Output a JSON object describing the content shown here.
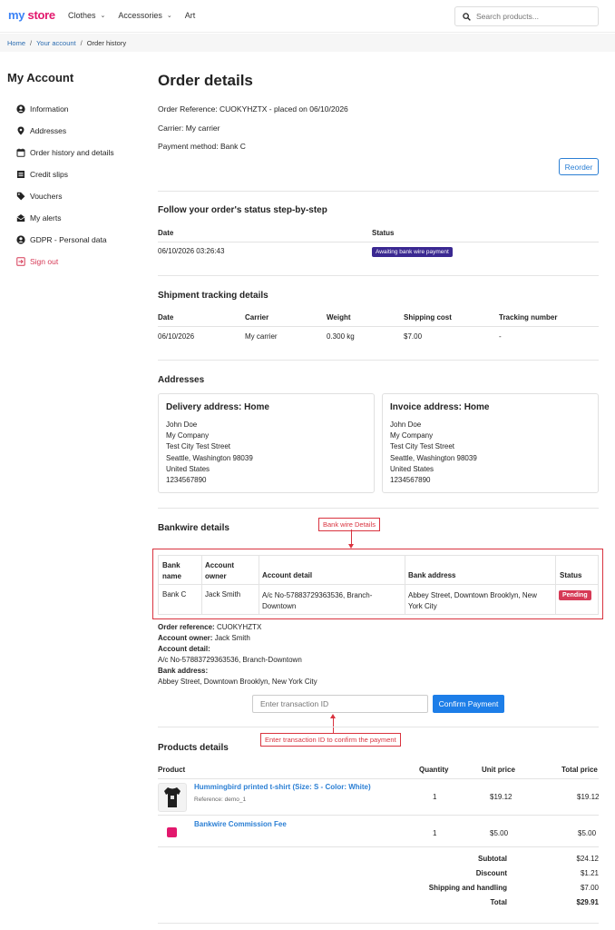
{
  "header": {
    "logo_my": "my",
    "logo_store": "store",
    "nav": [
      {
        "label": "Clothes",
        "has_dropdown": true
      },
      {
        "label": "Accessories",
        "has_dropdown": true
      },
      {
        "label": "Art",
        "has_dropdown": false
      }
    ],
    "search_placeholder": "Search products..."
  },
  "breadcrumb": {
    "items": [
      "Home",
      "Your account",
      "Order history"
    ],
    "separator": "/"
  },
  "sidebar": {
    "title": "My Account",
    "items": [
      {
        "label": "Information",
        "icon": "user-icon"
      },
      {
        "label": "Addresses",
        "icon": "map-pin-icon"
      },
      {
        "label": "Order history and details",
        "icon": "calendar-icon"
      },
      {
        "label": "Credit slips",
        "icon": "list-icon"
      },
      {
        "label": "Vouchers",
        "icon": "tag-icon"
      },
      {
        "label": "My alerts",
        "icon": "envelope-open-icon"
      },
      {
        "label": "GDPR - Personal data",
        "icon": "user-circle-icon"
      },
      {
        "label": "Sign out",
        "icon": "sign-out-icon"
      }
    ]
  },
  "order": {
    "title": "Order details",
    "reference_line": "Order Reference: CUOKYHZTX - placed on 06/10/2026",
    "carrier_line": "Carrier: My carrier",
    "payment_line": "Payment method: Bank C",
    "reorder_label": "Reorder"
  },
  "status_section": {
    "title": "Follow your order's status step-by-step",
    "headers": [
      "Date",
      "Status"
    ],
    "rows": [
      {
        "date": "06/10/2026 03:26:43",
        "status": "Awaiting bank wire payment"
      }
    ]
  },
  "shipment_section": {
    "title": "Shipment tracking details",
    "headers": [
      "Date",
      "Carrier",
      "Weight",
      "Shipping cost",
      "Tracking number"
    ],
    "rows": [
      [
        "06/10/2026",
        "My carrier",
        "0.300 kg",
        "$7.00",
        "-"
      ]
    ]
  },
  "addresses_section": {
    "title": "Addresses",
    "delivery": {
      "title": "Delivery address: Home",
      "lines": [
        "John Doe",
        "My Company",
        "Test City Test Street",
        "Seattle, Washington 98039",
        "United States",
        "1234567890"
      ]
    },
    "invoice": {
      "title": "Invoice address: Home",
      "lines": [
        "John Doe",
        "My Company",
        "Test City Test Street",
        "Seattle, Washington 98039",
        "United States",
        "1234567890"
      ]
    }
  },
  "bankwire_section": {
    "title": "Bankwire details",
    "callout": "Bank wire Details",
    "headers": [
      "Bank name",
      "Account owner",
      "Account detail",
      "Bank address",
      "Status"
    ],
    "header_lines": [
      [
        "Bank",
        "name"
      ],
      [
        "Account",
        "owner"
      ],
      [
        "Account detail"
      ],
      [
        "Bank address"
      ],
      [
        "Status"
      ]
    ],
    "row": {
      "bank_name": "Bank C",
      "account_owner": "Jack Smith",
      "account_detail_l1": "A/c No-57883729363536, Branch-",
      "account_detail_l2": "Downtown",
      "bank_address_l1": "Abbey Street, Downtown Brooklyn, New",
      "bank_address_l2": "York City",
      "status": "Pending"
    },
    "summary": {
      "order_reference_label": "Order reference:",
      "order_reference": "CUOKYHZTX",
      "account_owner_label": "Account owner:",
      "account_owner": "Jack Smith",
      "account_detail_label": "Account detail:",
      "account_detail": "A/c No-57883729363536, Branch-Downtown",
      "bank_address_label": "Bank address:",
      "bank_address": "Abbey Street, Downtown Brooklyn, New York City"
    },
    "transaction_placeholder": "Enter transaction ID",
    "confirm_label": "Confirm Payment",
    "txn_callout": "Enter transaction ID to confirm the payment"
  },
  "products_section": {
    "title": "Products details",
    "headers": [
      "Product",
      "Quantity",
      "Unit price",
      "Total price"
    ],
    "items": [
      {
        "name": "Hummingbird printed t-shirt (Size: S - Color: White)",
        "reference": "Reference: demo_1",
        "quantity": "1",
        "unit_price": "$19.12",
        "total_price": "$19.12"
      },
      {
        "name": "Bankwire Commission Fee",
        "reference": "",
        "quantity": "1",
        "unit_price": "$5.00",
        "total_price": "$5.00"
      }
    ],
    "totals": [
      {
        "label": "Subtotal",
        "value": "$24.12"
      },
      {
        "label": "Discount",
        "value": "$1.21"
      },
      {
        "label": "Shipping and handling",
        "value": "$7.00"
      },
      {
        "label": "Total",
        "value": "$29.91"
      }
    ]
  },
  "colors": {
    "accent": "#2b7fd4",
    "status_awaiting": "#3a2891",
    "status_pending": "#d63a56",
    "callout": "#d9333f",
    "logo_blue": "#3b82f6",
    "logo_pink": "#e2186d"
  }
}
